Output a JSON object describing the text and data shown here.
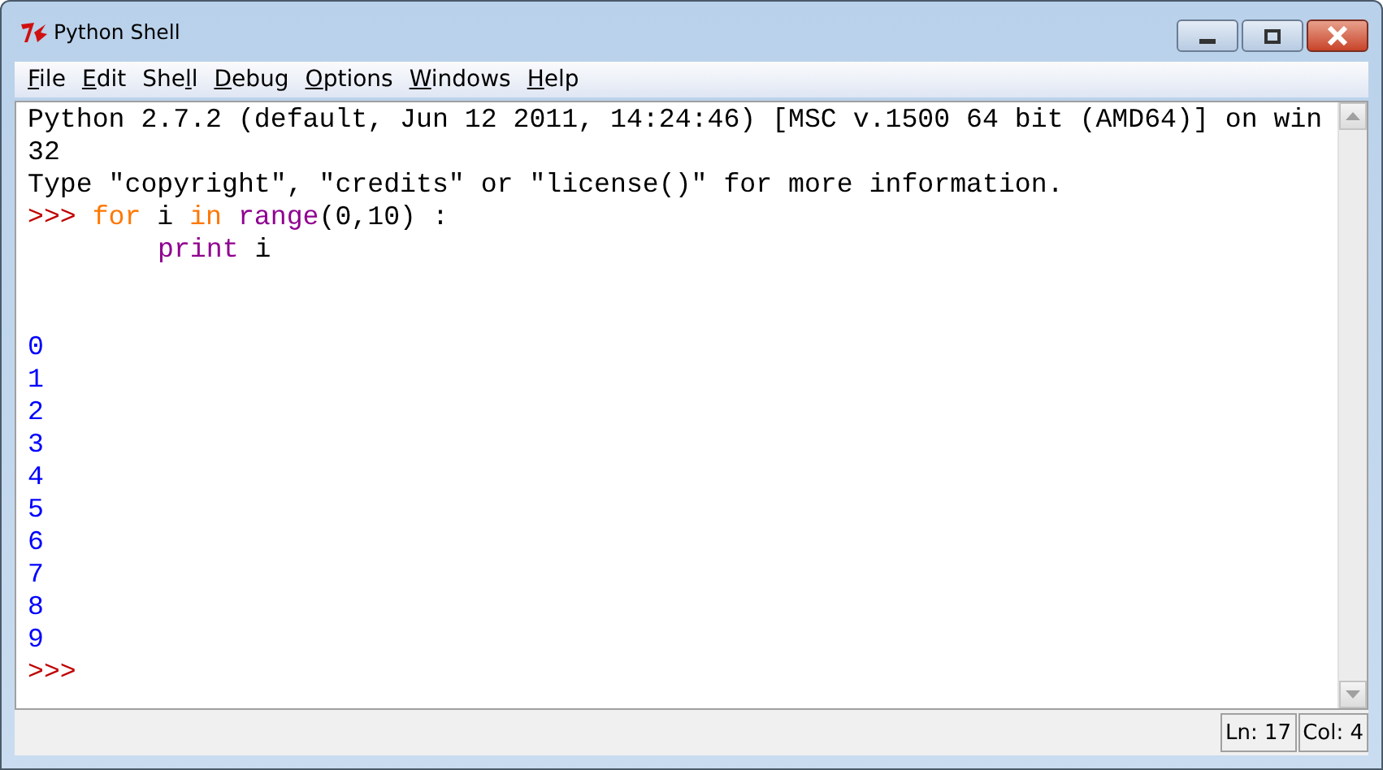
{
  "window": {
    "title": "Python Shell"
  },
  "menu": [
    {
      "key": "F",
      "after": "ile"
    },
    {
      "key": "E",
      "after": "dit"
    },
    {
      "before": "She",
      "key": "l",
      "after": "l"
    },
    {
      "key": "D",
      "after": "ebug"
    },
    {
      "key": "O",
      "after": "ptions"
    },
    {
      "key": "W",
      "after": "indows"
    },
    {
      "key": "H",
      "after": "elp"
    }
  ],
  "shell_lines": [
    {
      "kind": "plain",
      "segments": [
        {
          "kind": "plain",
          "text": "Python 2.7.2 (default, Jun 12 2011, 14:24:46) [MSC v.1500 64 bit (AMD64)] on win"
        }
      ]
    },
    {
      "kind": "plain",
      "segments": [
        {
          "kind": "plain",
          "text": "32"
        }
      ]
    },
    {
      "kind": "plain",
      "segments": [
        {
          "kind": "plain",
          "text": "Type \"copyright\", \"credits\" or \"license()\" for more information."
        }
      ]
    },
    {
      "kind": "plain",
      "segments": [
        {
          "kind": "prompt",
          "text": ">>> "
        },
        {
          "kind": "keyword",
          "text": "for"
        },
        {
          "kind": "plain",
          "text": " i "
        },
        {
          "kind": "keyword",
          "text": "in "
        },
        {
          "kind": "builtin",
          "text": "range"
        },
        {
          "kind": "plain",
          "text": "(0,10) :"
        }
      ]
    },
    {
      "kind": "indented",
      "segments": [
        {
          "kind": "keyword2",
          "text": "print"
        },
        {
          "kind": "plain",
          "text": " i"
        }
      ]
    },
    {
      "kind": "after_gap",
      "segments": [
        {
          "kind": "output",
          "text": "0"
        }
      ]
    },
    {
      "kind": "plain",
      "segments": [
        {
          "kind": "output",
          "text": "1"
        }
      ]
    },
    {
      "kind": "plain",
      "segments": [
        {
          "kind": "output",
          "text": "2"
        }
      ]
    },
    {
      "kind": "plain",
      "segments": [
        {
          "kind": "output",
          "text": "3"
        }
      ]
    },
    {
      "kind": "plain",
      "segments": [
        {
          "kind": "output",
          "text": "4"
        }
      ]
    },
    {
      "kind": "plain",
      "segments": [
        {
          "kind": "output",
          "text": "5"
        }
      ]
    },
    {
      "kind": "plain",
      "segments": [
        {
          "kind": "output",
          "text": "6"
        }
      ]
    },
    {
      "kind": "plain",
      "segments": [
        {
          "kind": "output",
          "text": "7"
        }
      ]
    },
    {
      "kind": "plain",
      "segments": [
        {
          "kind": "output",
          "text": "8"
        }
      ]
    },
    {
      "kind": "plain",
      "segments": [
        {
          "kind": "output",
          "text": "9"
        }
      ]
    },
    {
      "kind": "plain",
      "segments": [
        {
          "kind": "prompt",
          "text": ">>>"
        }
      ]
    }
  ],
  "status_bar": {
    "line": "Ln: 17",
    "column": "Col: 4"
  }
}
